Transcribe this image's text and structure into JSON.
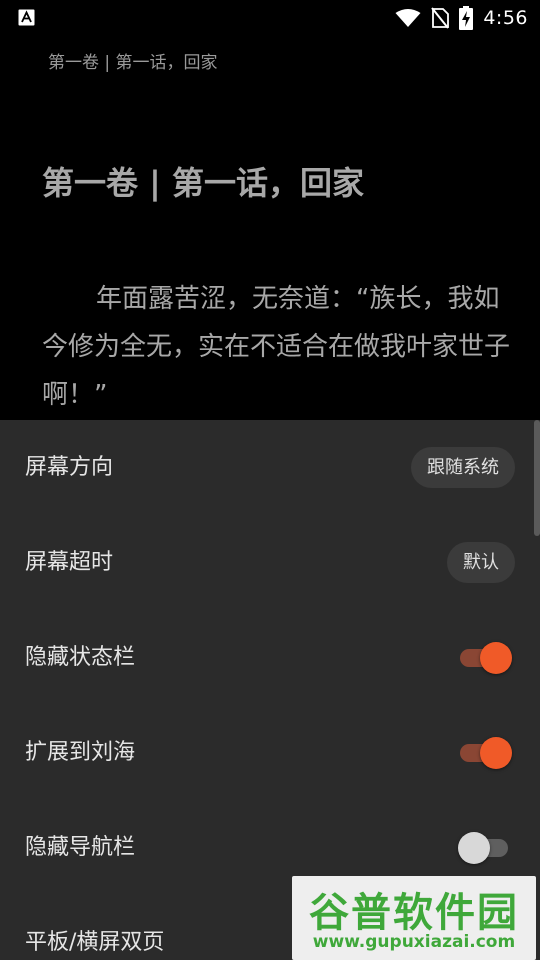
{
  "status_bar": {
    "time": "4:56",
    "icons": [
      "app-notification-icon",
      "wifi-icon",
      "no-sim-icon",
      "battery-charging-icon"
    ]
  },
  "reader": {
    "header": "第一卷 | 第一话，回家",
    "chapter_title": "第一卷 | 第一话，回家",
    "paragraph": "年面露苦涩，无奈道：“族长，我如今修为全无，实在不适合在做我叶家世子啊！”"
  },
  "settings": {
    "rows": [
      {
        "label": "屏幕方向",
        "type": "select",
        "value": "跟随系统"
      },
      {
        "label": "屏幕超时",
        "type": "select",
        "value": "默认"
      },
      {
        "label": "隐藏状态栏",
        "type": "switch",
        "on": true
      },
      {
        "label": "扩展到刘海",
        "type": "switch",
        "on": true
      },
      {
        "label": "隐藏导航栏",
        "type": "switch",
        "on": false
      },
      {
        "label": "平板/横屏双页",
        "type": "switch"
      }
    ]
  },
  "watermark": {
    "text": "谷普软件园",
    "url": "www.gupuxiazai.com"
  },
  "colors": {
    "accent": "#f05a28",
    "sheet_bg": "#2b2b2b",
    "watermark": "#3fa83a"
  }
}
